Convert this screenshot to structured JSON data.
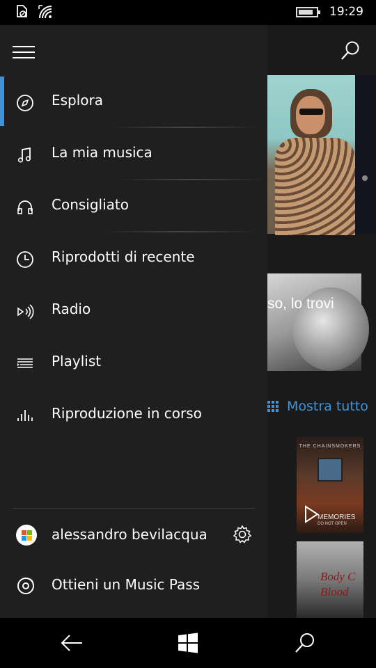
{
  "status_bar": {
    "time": "19:29",
    "icons": [
      "no-sim-icon",
      "wifi-icon",
      "battery-icon"
    ],
    "battery_percent": 70
  },
  "header": {
    "menu_icon": "hamburger-icon",
    "search_icon": "search-icon"
  },
  "nav": {
    "items": [
      {
        "label": "Esplora",
        "icon": "compass-icon",
        "active": true
      },
      {
        "label": "La mia musica",
        "icon": "music-note-icon",
        "active": false
      },
      {
        "label": "Consigliato",
        "icon": "headphones-icon",
        "active": false
      },
      {
        "label": "Riprodotti di recente",
        "icon": "clock-icon",
        "active": false
      },
      {
        "label": "Radio",
        "icon": "radio-icon",
        "active": false
      },
      {
        "label": "Playlist",
        "icon": "playlist-icon",
        "active": false
      },
      {
        "label": "Riproduzione in corso",
        "icon": "equalizer-icon",
        "active": false
      }
    ]
  },
  "account": {
    "user_name": "alessandro bevilacqua",
    "settings_icon": "gear-icon",
    "music_pass_label": "Ottieni un Music Pass"
  },
  "background": {
    "promo_text": "so, lo trovi",
    "show_all_label": "Mostra tutto",
    "album1_title": "THE CHAINSMOKERS",
    "album1_name": "MEMORIES",
    "album1_sub": "DO NOT OPEN",
    "album2_text": "Body C Blood"
  },
  "colors": {
    "accent": "#3f94d9",
    "drawer_bg": "#1f1f1f",
    "app_bg": "#1a1a1a"
  }
}
